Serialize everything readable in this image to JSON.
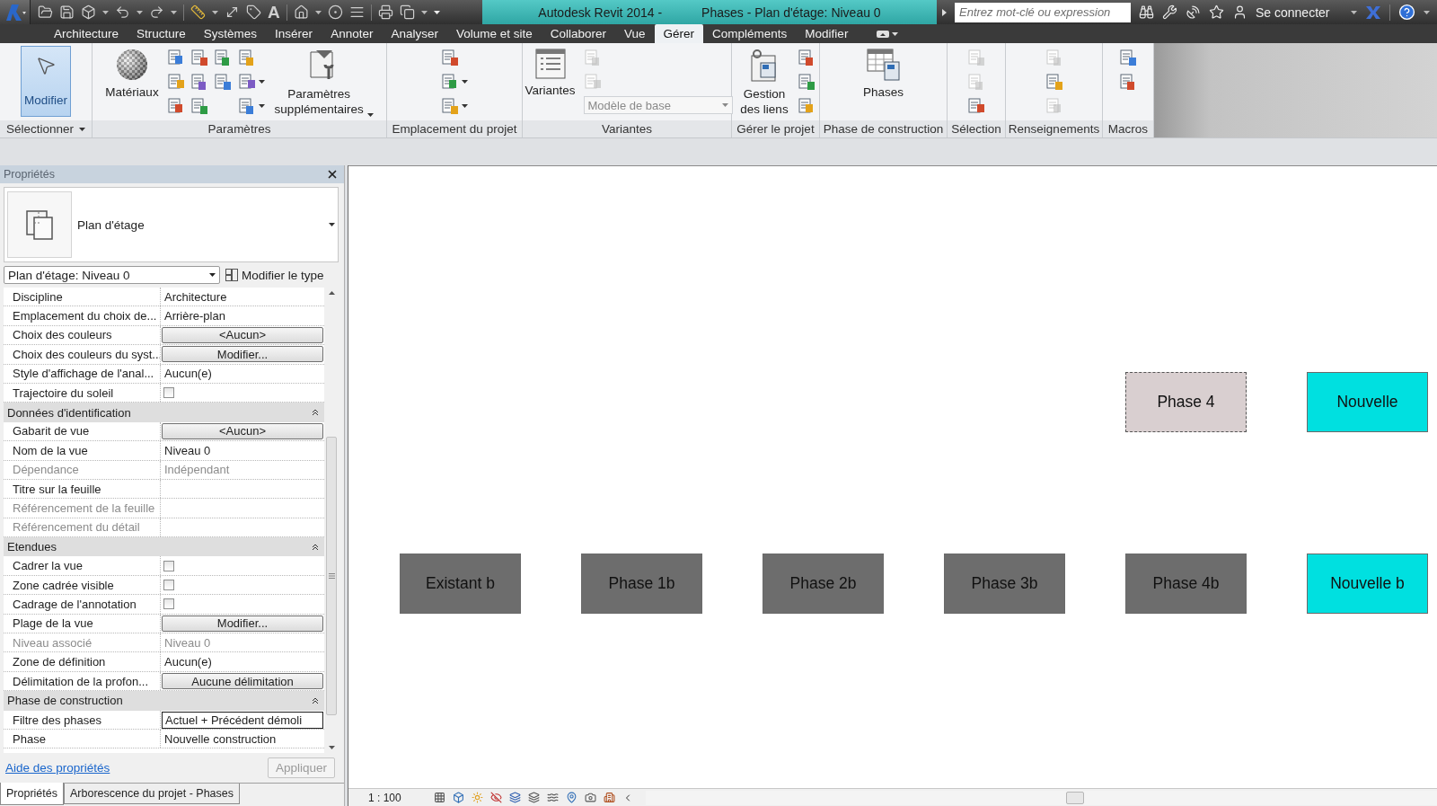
{
  "title_bar": {
    "quick_access": {
      "text_glyph": "A"
    },
    "app_title": "Autodesk Revit 2014 -",
    "document_title": "Phases - Plan d'étage: Niveau 0",
    "search": {
      "placeholder": "Entrez mot-clé ou expression"
    },
    "sign_in": "Se connecter"
  },
  "menu_tabs": [
    {
      "label": "Architecture",
      "selected": false
    },
    {
      "label": "Structure",
      "selected": false
    },
    {
      "label": "Systèmes",
      "selected": false
    },
    {
      "label": "Insérer",
      "selected": false
    },
    {
      "label": "Annoter",
      "selected": false
    },
    {
      "label": "Analyser",
      "selected": false
    },
    {
      "label": "Volume et site",
      "selected": false
    },
    {
      "label": "Collaborer",
      "selected": false
    },
    {
      "label": "Vue",
      "selected": false
    },
    {
      "label": "Gérer",
      "selected": true
    },
    {
      "label": "Compléments",
      "selected": false
    },
    {
      "label": "Modifier",
      "selected": false
    }
  ],
  "ribbon": {
    "panels": [
      {
        "label": "Sélectionner",
        "dropdown": true,
        "tools": [
          {
            "kind": "large",
            "label": "Modifier",
            "selected": true,
            "dropdown": false
          }
        ]
      },
      {
        "label": "Paramètres",
        "dropdown": false,
        "tools": [
          {
            "kind": "large",
            "label": "Matériaux",
            "selected": false,
            "dropdown": false
          },
          {
            "kind": "grid",
            "items": [
              {
                "kind": "icon",
                "disabled": false,
                "dropdown": false
              },
              {
                "kind": "icon",
                "disabled": false,
                "dropdown": false
              },
              {
                "kind": "icon",
                "disabled": false,
                "dropdown": false
              },
              {
                "kind": "icon",
                "disabled": false,
                "dropdown": false
              },
              {
                "kind": "icon",
                "disabled": false,
                "dropdown": false
              },
              {
                "kind": "icon",
                "disabled": false,
                "dropdown": false
              },
              {
                "kind": "icon",
                "disabled": false,
                "dropdown": false
              },
              {
                "kind": "icon",
                "disabled": false,
                "dropdown": false
              }
            ]
          },
          {
            "kind": "stack",
            "items": [
              {
                "kind": "icon",
                "disabled": false,
                "dropdown": false
              },
              {
                "kind": "icon",
                "disabled": false,
                "dropdown": true
              },
              {
                "kind": "icon",
                "disabled": false,
                "dropdown": true
              }
            ]
          },
          {
            "kind": "large",
            "label": "Paramètres supplémentaires",
            "selected": false,
            "dropdown": true
          }
        ]
      },
      {
        "label": "Emplacement du projet",
        "dropdown": false,
        "tools": [
          {
            "kind": "stack",
            "items": [
              {
                "kind": "icon",
                "disabled": false,
                "dropdown": false
              },
              {
                "kind": "icon",
                "disabled": false,
                "dropdown": true
              },
              {
                "kind": "icon",
                "disabled": false,
                "dropdown": true
              }
            ]
          }
        ]
      },
      {
        "label": "Variantes",
        "dropdown": false,
        "tools": [
          {
            "kind": "large",
            "label": "Variantes",
            "selected": false,
            "dropdown": false
          },
          {
            "kind": "stack",
            "items": [
              {
                "kind": "icon",
                "disabled": true,
                "dropdown": false
              },
              {
                "kind": "icon",
                "disabled": true,
                "dropdown": false
              },
              {
                "kind": "combo",
                "value": "Modèle de base",
                "disabled": true
              }
            ]
          }
        ]
      },
      {
        "label": "Gérer le projet",
        "dropdown": false,
        "tools": [
          {
            "kind": "large",
            "label": "Gestion des liens",
            "selected": false,
            "dropdown": false
          },
          {
            "kind": "stack",
            "items": [
              {
                "kind": "icon",
                "disabled": false,
                "dropdown": false
              },
              {
                "kind": "icon",
                "disabled": false,
                "dropdown": false
              },
              {
                "kind": "icon",
                "disabled": false,
                "dropdown": false
              }
            ]
          }
        ]
      },
      {
        "label": "Phase de construction",
        "dropdown": false,
        "tools": [
          {
            "kind": "large",
            "label": "Phases",
            "selected": false,
            "dropdown": false
          }
        ]
      },
      {
        "label": "Sélection",
        "dropdown": false,
        "tools": [
          {
            "kind": "stack",
            "items": [
              {
                "kind": "icon",
                "disabled": true,
                "dropdown": false
              },
              {
                "kind": "icon",
                "disabled": true,
                "dropdown": false
              },
              {
                "kind": "icon",
                "disabled": false,
                "dropdown": false
              }
            ]
          }
        ]
      },
      {
        "label": "Renseignements",
        "dropdown": false,
        "tools": [
          {
            "kind": "stack",
            "items": [
              {
                "kind": "icon",
                "disabled": true,
                "dropdown": false
              },
              {
                "kind": "icon",
                "disabled": false,
                "dropdown": false
              },
              {
                "kind": "icon",
                "disabled": true,
                "dropdown": false
              }
            ]
          }
        ]
      },
      {
        "label": "Macros",
        "dropdown": false,
        "tools": [
          {
            "kind": "stack",
            "items": [
              {
                "kind": "icon",
                "disabled": false,
                "dropdown": false
              },
              {
                "kind": "icon",
                "disabled": false,
                "dropdown": false
              }
            ]
          }
        ]
      }
    ]
  },
  "properties": {
    "title": "Propriétés",
    "type_name": "Plan d'étage",
    "instance": "Plan d'étage: Niveau 0",
    "edit_type": "Modifier le type",
    "rows": [
      {
        "kind": "text",
        "label": "Discipline",
        "value": "Architecture",
        "disabled": false
      },
      {
        "kind": "text",
        "label": "Emplacement du choix de...",
        "value": "Arrière-plan",
        "disabled": false
      },
      {
        "kind": "button",
        "label": "Choix des couleurs",
        "value": "<Aucun>",
        "disabled": false
      },
      {
        "kind": "button",
        "label": "Choix des couleurs du syst...",
        "value": "Modifier...",
        "disabled": false
      },
      {
        "kind": "text",
        "label": "Style d'affichage de l'anal...",
        "value": "Aucun(e)",
        "disabled": false
      },
      {
        "kind": "checkbox",
        "label": "Trajectoire du soleil",
        "checked": false,
        "disabled": false
      },
      {
        "kind": "group",
        "label": "Données d'identification",
        "expanded": true
      },
      {
        "kind": "button",
        "label": "Gabarit de vue",
        "value": "<Aucun>",
        "disabled": false
      },
      {
        "kind": "text",
        "label": "Nom de la vue",
        "value": "Niveau 0",
        "disabled": false
      },
      {
        "kind": "text",
        "label": "Dépendance",
        "value": "Indépendant",
        "disabled": true
      },
      {
        "kind": "text",
        "label": "Titre sur la feuille",
        "disabled": false
      },
      {
        "kind": "text",
        "label": "Référencement de la feuille",
        "disabled": true
      },
      {
        "kind": "text",
        "label": "Référencement du détail",
        "disabled": true
      },
      {
        "kind": "group",
        "label": "Etendues",
        "expanded": true
      },
      {
        "kind": "checkbox",
        "label": "Cadrer la vue",
        "checked": false,
        "disabled": false
      },
      {
        "kind": "checkbox",
        "label": "Zone cadrée visible",
        "checked": false,
        "disabled": false
      },
      {
        "kind": "checkbox",
        "label": "Cadrage de l'annotation",
        "checked": false,
        "disabled": false
      },
      {
        "kind": "button",
        "label": "Plage de la vue",
        "value": "Modifier...",
        "disabled": false
      },
      {
        "kind": "text",
        "label": "Niveau associé",
        "value": "Niveau 0",
        "disabled": true
      },
      {
        "kind": "text",
        "label": "Zone de définition",
        "value": "Aucun(e)",
        "disabled": false
      },
      {
        "kind": "button",
        "label": "Délimitation de la profon...",
        "value": "Aucune délimitation",
        "disabled": false
      },
      {
        "kind": "group",
        "label": "Phase de construction",
        "expanded": true
      },
      {
        "kind": "input",
        "label": "Filtre des phases",
        "value": "Actuel + Précédent démoli",
        "disabled": false
      },
      {
        "kind": "text",
        "label": "Phase",
        "value": "Nouvelle construction",
        "disabled": false
      }
    ],
    "help_link": "Aide des propriétés",
    "apply": {
      "label": "Appliquer",
      "disabled": true
    }
  },
  "bottom_tabs": [
    {
      "label": "Propriétés",
      "selected": true
    },
    {
      "label": "Arborescence du projet - Phases",
      "selected": false
    }
  ],
  "canvas": {
    "rows": [
      {
        "blocks": [
          {
            "label": "Phase 4",
            "color": "#d9cfd0",
            "selected": true
          },
          {
            "label": "Nouvelle",
            "color": "#00e0e0",
            "selected": false
          }
        ]
      },
      {
        "blocks": [
          {
            "label": "Existant b",
            "color": "#6d6d6d",
            "selected": false
          },
          {
            "label": "Phase 1b",
            "color": "#6d6d6d",
            "selected": false
          },
          {
            "label": "Phase 2b",
            "color": "#6d6d6d",
            "selected": false
          },
          {
            "label": "Phase 3b",
            "color": "#6d6d6d",
            "selected": false
          },
          {
            "label": "Phase 4b",
            "color": "#6d6d6d",
            "selected": false
          },
          {
            "label": "Nouvelle b",
            "color": "#00e0e0",
            "selected": false
          }
        ]
      }
    ]
  },
  "status_bar": {
    "scale": "1 : 100"
  }
}
